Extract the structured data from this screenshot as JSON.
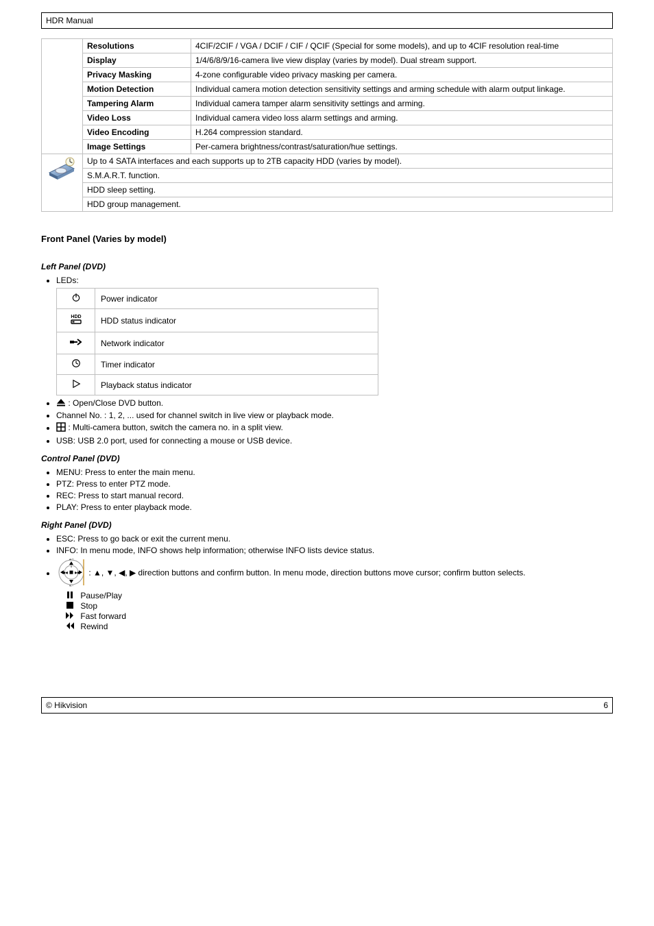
{
  "header": {
    "title": "HDR Manual"
  },
  "spec_table_top": {
    "rows_a": [
      {
        "label": "Resolutions",
        "desc": "4CIF/2CIF / VGA / DCIF / CIF / QCIF (Special for some models), and up to 4CIF resolution real-time"
      },
      {
        "label": "Display",
        "desc": "1/4/6/8/9/16-camera live view display (varies by model). Dual stream support."
      },
      {
        "label": "Privacy Masking",
        "desc": "4-zone configurable video privacy masking per camera."
      },
      {
        "label": "Motion Detection",
        "desc": "Individual camera motion detection sensitivity settings and arming schedule with alarm output linkage."
      },
      {
        "label": "Tampering Alarm",
        "desc": "Individual camera tamper alarm sensitivity settings and arming."
      },
      {
        "label": "Video Loss",
        "desc": "Individual camera video loss alarm settings and arming."
      },
      {
        "label": "Video Encoding",
        "desc": "H.264 compression standard."
      },
      {
        "label": "Image Settings",
        "desc": "Per-camera brightness/contrast/saturation/hue settings."
      }
    ],
    "rows_b": [
      "Up to 4 SATA interfaces and each supports up to 2TB capacity HDD (varies by model).",
      "S.M.A.R.T. function.",
      "HDD sleep setting.",
      "HDD group management."
    ]
  },
  "leds": {
    "caption": "LEDs:",
    "rows": [
      {
        "label": "Power indicator"
      },
      {
        "label": "HDD status indicator"
      },
      {
        "label": "Network indicator"
      },
      {
        "label": "Timer indicator"
      },
      {
        "label": "Playback status indicator"
      }
    ]
  },
  "list_after_leds": [
    {
      "icon": "eject",
      "text": ": Open/Close DVD button."
    },
    {
      "text": "Channel No. : 1, 2, ... used for channel switch in live view or playback mode."
    },
    {
      "icon": "grid",
      "text": ": Multi-camera button, switch the camera no. in a split view."
    },
    {
      "text": "USB: USB 2.0 port, used for connecting a mouse or USB device."
    }
  ],
  "control_panel": {
    "heading": "Control Panel (DVD)",
    "items": [
      "MENU: Press to enter the main menu.",
      "PTZ: Press to enter PTZ mode.",
      "REC: Press to start manual record.",
      "PLAY: Press to enter playback mode."
    ]
  },
  "right_panel": {
    "heading": "Right Panel (DVD)",
    "items": [
      {
        "text": "ESC: Press to go back or exit the current menu."
      },
      {
        "text": "INFO: In menu mode, INFO shows help information; otherwise INFO lists device status."
      },
      {
        "dpad": true,
        "text": ": ▲, ▼, ◀, ▶ direction buttons and confirm button. In menu mode, direction buttons move cursor; confirm button selects."
      }
    ],
    "sublist": [
      {
        "icon": "pause",
        "text": "Pause/Play"
      },
      {
        "icon": "stop",
        "text": "Stop"
      },
      {
        "icon": "ffwd",
        "text": "Fast forward"
      },
      {
        "icon": "rew",
        "text": "Rewind"
      }
    ]
  },
  "sections": {
    "front_panel": "Front Panel (Varies by model)",
    "left_panel": "Left Panel (DVD)"
  },
  "footer": {
    "left": "© Hikvision",
    "right": "6"
  }
}
